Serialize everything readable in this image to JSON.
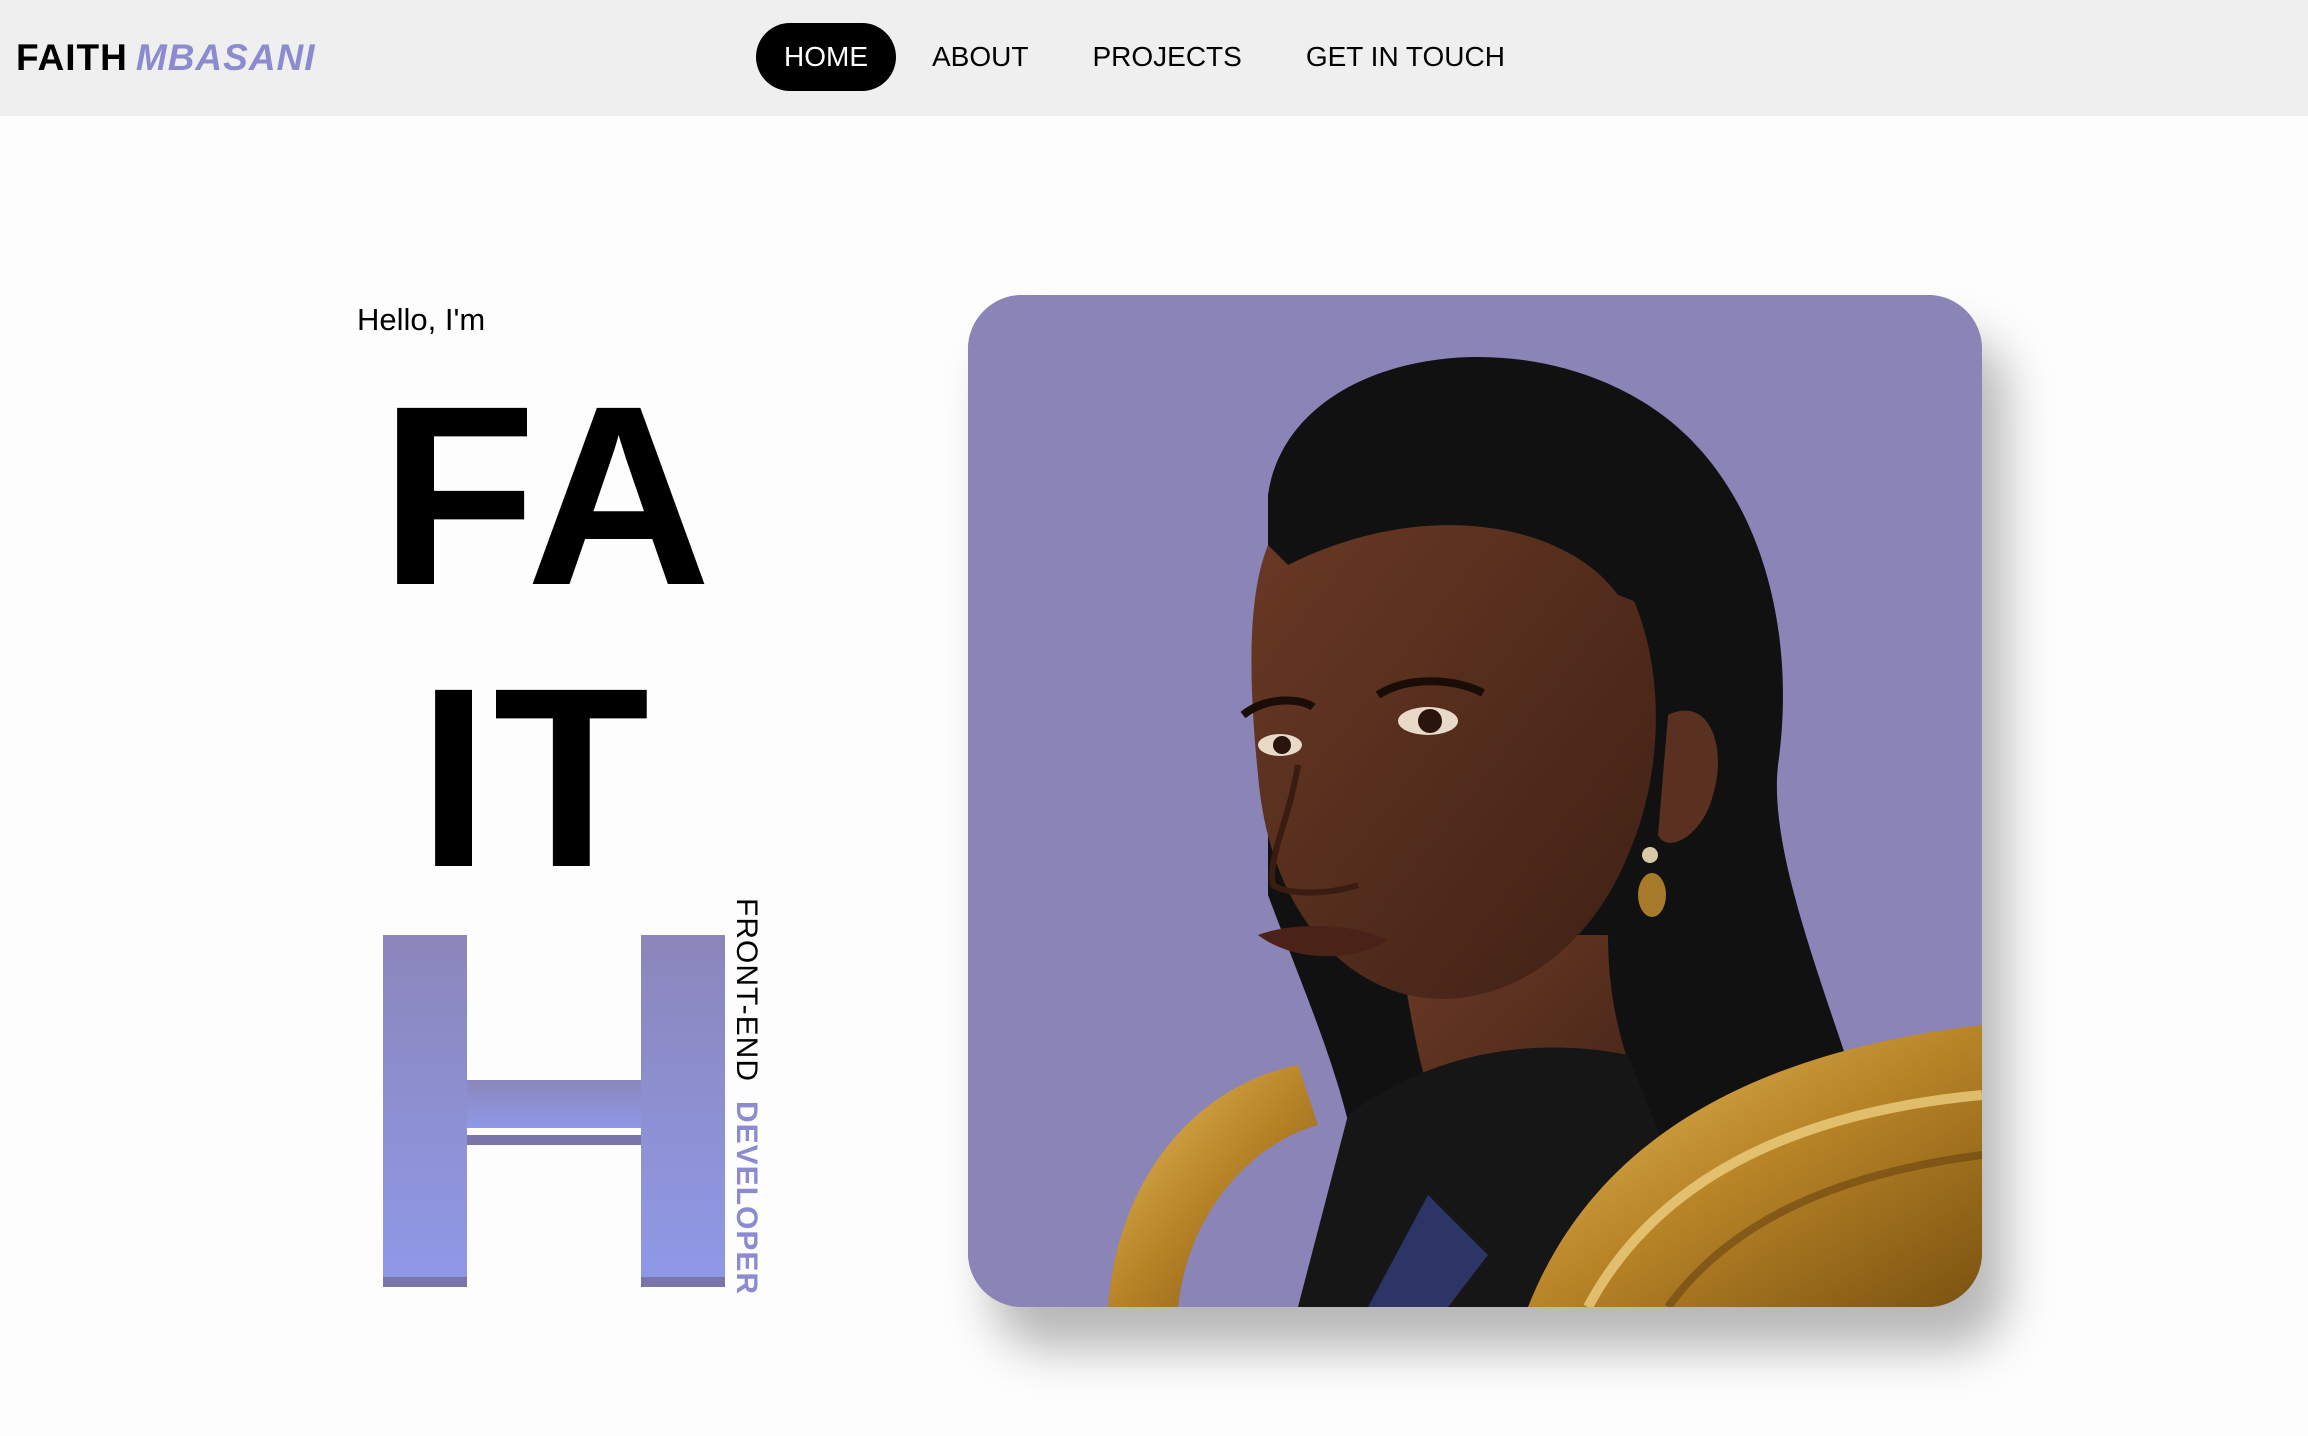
{
  "header": {
    "brand_first": "FAITH",
    "brand_last": "MBASANI",
    "nav": [
      {
        "label": "HOME",
        "active": true
      },
      {
        "label": "ABOUT",
        "active": false
      },
      {
        "label": "PROJECTS",
        "active": false
      },
      {
        "label": "GET IN TOUCH",
        "active": false
      }
    ]
  },
  "hero": {
    "greeting": "Hello, I'm",
    "name_line1": "FA",
    "name_line2": "IT",
    "name_line3": "H",
    "role_part1": "FRONT-END",
    "role_part2": "DEVELOPER"
  },
  "colors": {
    "accent": "#8d8bcf",
    "photo_bg": "#8a84b7",
    "nav_active_bg": "#000000"
  }
}
